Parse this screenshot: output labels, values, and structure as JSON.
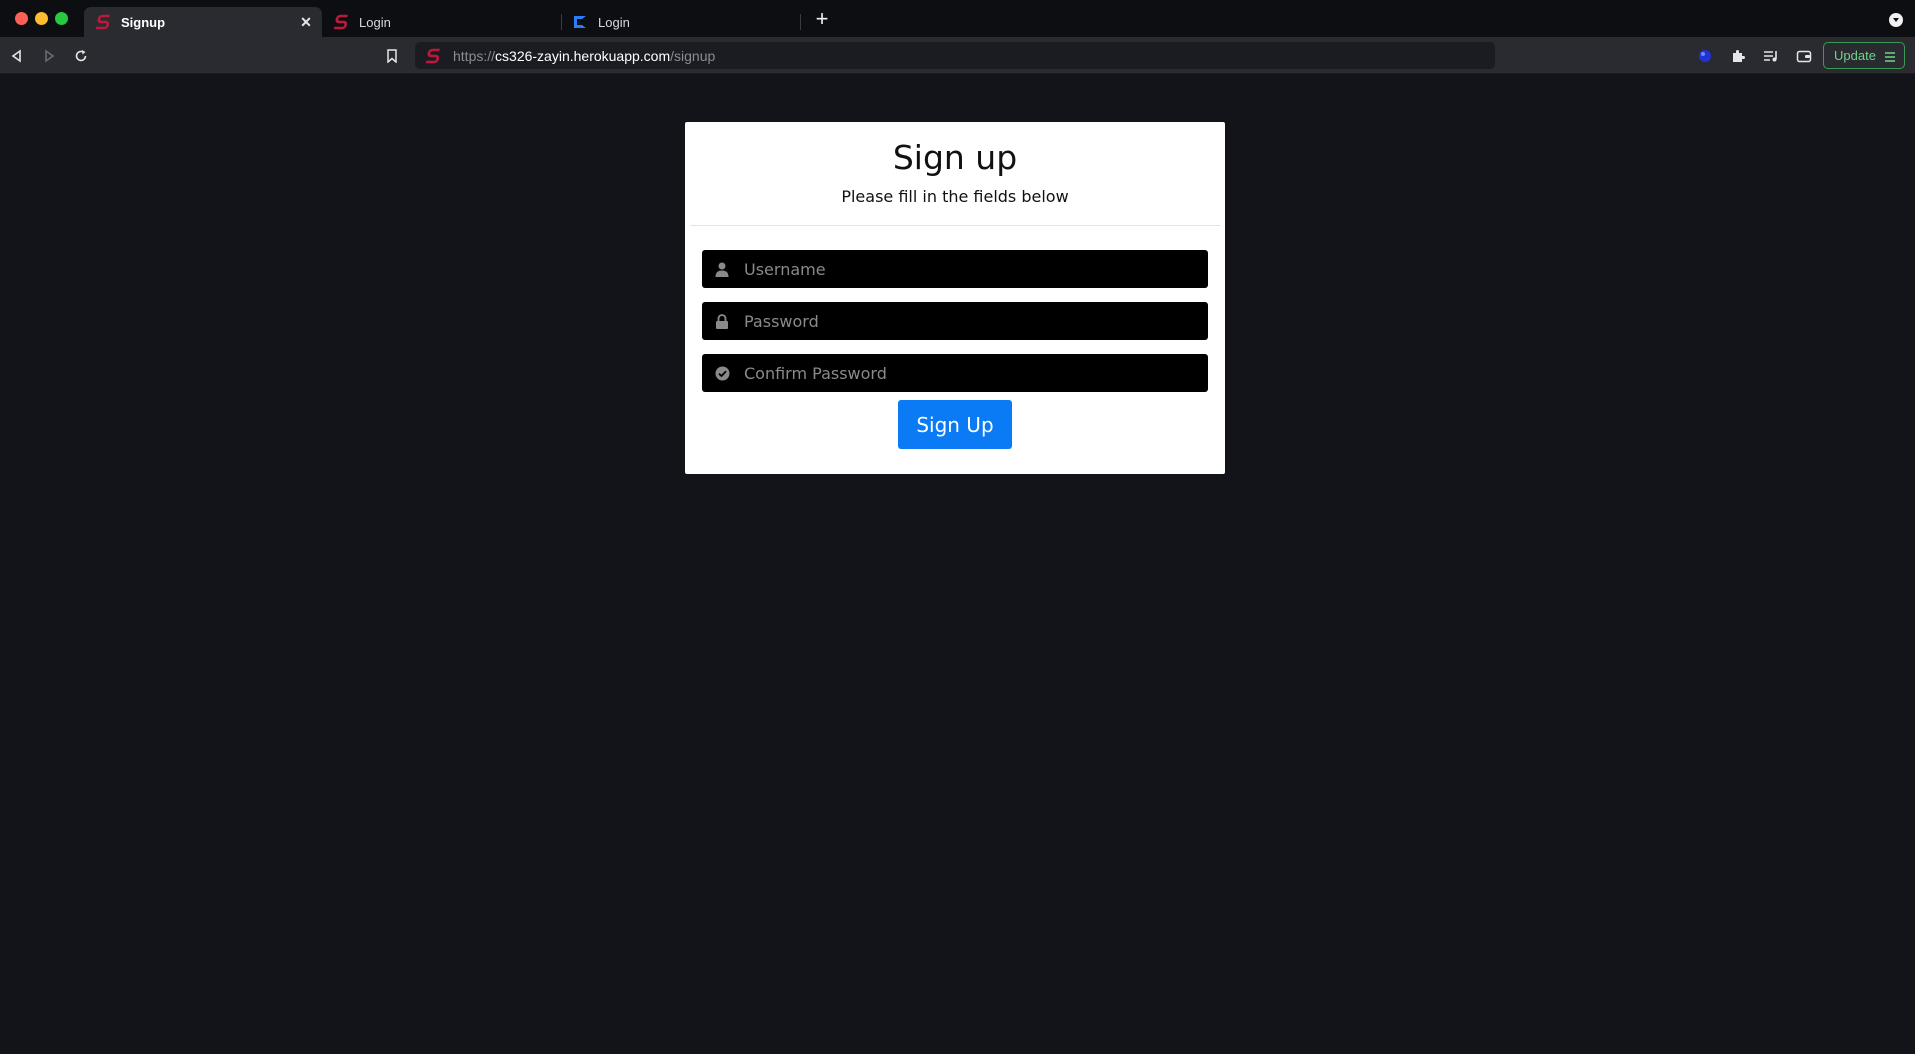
{
  "browser": {
    "tabs": [
      {
        "title": "Signup",
        "active": true,
        "favicon": "red-s-logo-icon"
      },
      {
        "title": "Login",
        "active": false,
        "favicon": "red-s-logo-icon"
      },
      {
        "title": "Login",
        "active": false,
        "favicon": "blue-k-logo-icon"
      }
    ],
    "url": {
      "scheme": "https://",
      "host": "cs326-zayin.herokuapp.com",
      "path": "/signup"
    },
    "update_label": "Update",
    "colors": {
      "accent_update": "#6fd38a",
      "favicon_red": "#c0183c",
      "favicon_blue": "#2f7df6"
    }
  },
  "page": {
    "title": "Sign up",
    "subtitle": "Please fill in the fields below",
    "fields": {
      "username": {
        "placeholder": "Username",
        "icon": "user-icon"
      },
      "password": {
        "placeholder": "Password",
        "icon": "lock-icon"
      },
      "confirm": {
        "placeholder": "Confirm Password",
        "icon": "check-circle-icon"
      }
    },
    "submit_label": "Sign Up",
    "colors": {
      "background": "#131419",
      "card": "#ffffff",
      "input_bg": "#000000",
      "button": "#0b7bf5"
    }
  }
}
